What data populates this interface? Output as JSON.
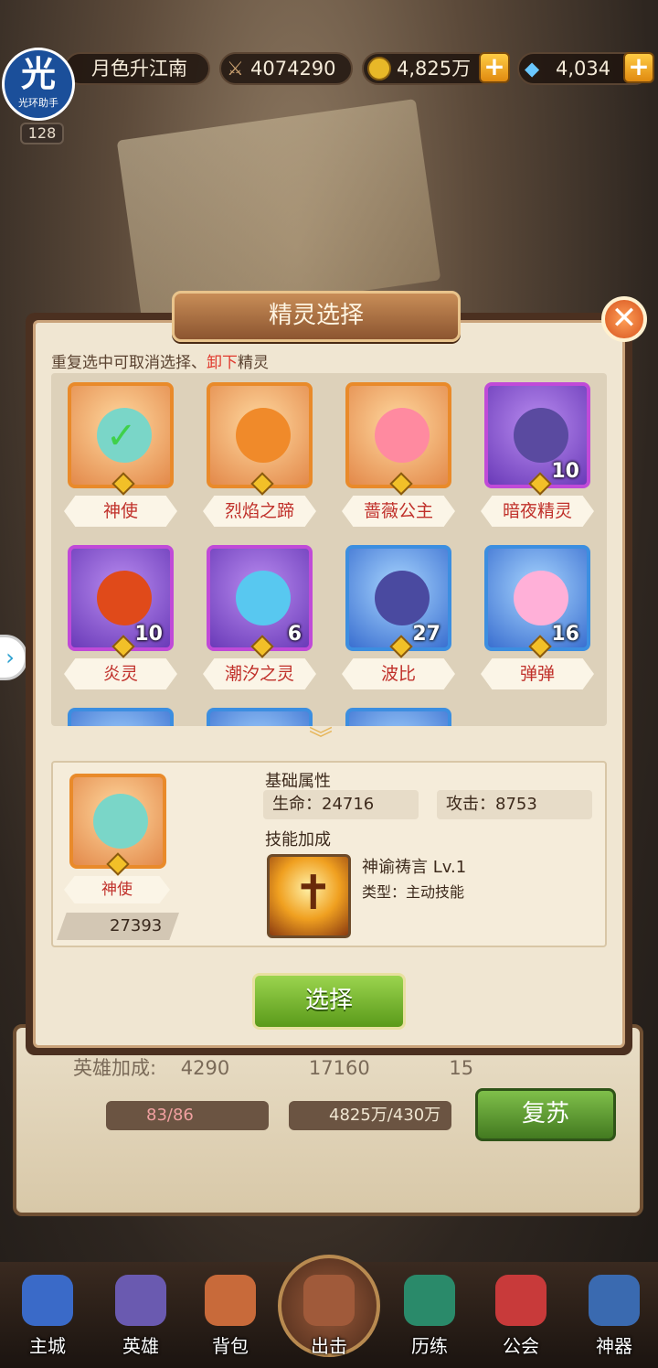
{
  "header": {
    "player_name": "月色升江南",
    "power": "4074290",
    "gold": "4,825万",
    "gems": "4,034",
    "avatar_text": "光",
    "avatar_sub": "光环助手",
    "level": "128"
  },
  "modal": {
    "title": "精灵选择",
    "hint_before": "重复选中可取消选择、",
    "hint_red": "卸下",
    "hint_after": "精灵",
    "close_label": "✕"
  },
  "spirits": [
    {
      "name": "神使",
      "level": "",
      "frame": "orange",
      "selected": true,
      "color": "#7ad6c8"
    },
    {
      "name": "烈焰之蹄",
      "level": "",
      "frame": "orange",
      "selected": false,
      "color": "#f08a2a"
    },
    {
      "name": "蔷薇公主",
      "level": "",
      "frame": "orange",
      "selected": false,
      "color": "#ff8aa0"
    },
    {
      "name": "暗夜精灵",
      "level": "10",
      "frame": "purple",
      "selected": false,
      "color": "#5a4aa0"
    },
    {
      "name": "炎灵",
      "level": "10",
      "frame": "purple",
      "selected": false,
      "color": "#e04a1a"
    },
    {
      "name": "潮汐之灵",
      "level": "6",
      "frame": "purple",
      "selected": false,
      "color": "#58c8f0"
    },
    {
      "name": "波比",
      "level": "27",
      "frame": "blue",
      "selected": false,
      "color": "#4a4aa0"
    },
    {
      "name": "弹弹",
      "level": "16",
      "frame": "blue",
      "selected": false,
      "color": "#ffb0d8"
    }
  ],
  "detail": {
    "name": "神使",
    "power": "27393",
    "base_title": "基础属性",
    "hp_label": "生命：24716",
    "atk_label": "攻击：8753",
    "skill_title": "技能加成",
    "skill_name": "神谕祷言 Lv.1",
    "skill_type": "类型：主动技能"
  },
  "select_label": "选择",
  "underlying": {
    "bonus_label": "英雄加成:",
    "atk": "4290",
    "hp": "17160",
    "def": "15",
    "potion": "83/86",
    "gold_cost": "4825万/430万",
    "revive_label": "复苏"
  },
  "nav": [
    {
      "label": "主城",
      "color": "#3a6ac8"
    },
    {
      "label": "英雄",
      "color": "#6a5ab0"
    },
    {
      "label": "背包",
      "color": "#c86a3a"
    },
    {
      "label": "出击",
      "color": "#a05a3a"
    },
    {
      "label": "历练",
      "color": "#2a8a6a"
    },
    {
      "label": "公会",
      "color": "#c83a3a"
    },
    {
      "label": "神器",
      "color": "#3a6ab0"
    }
  ]
}
